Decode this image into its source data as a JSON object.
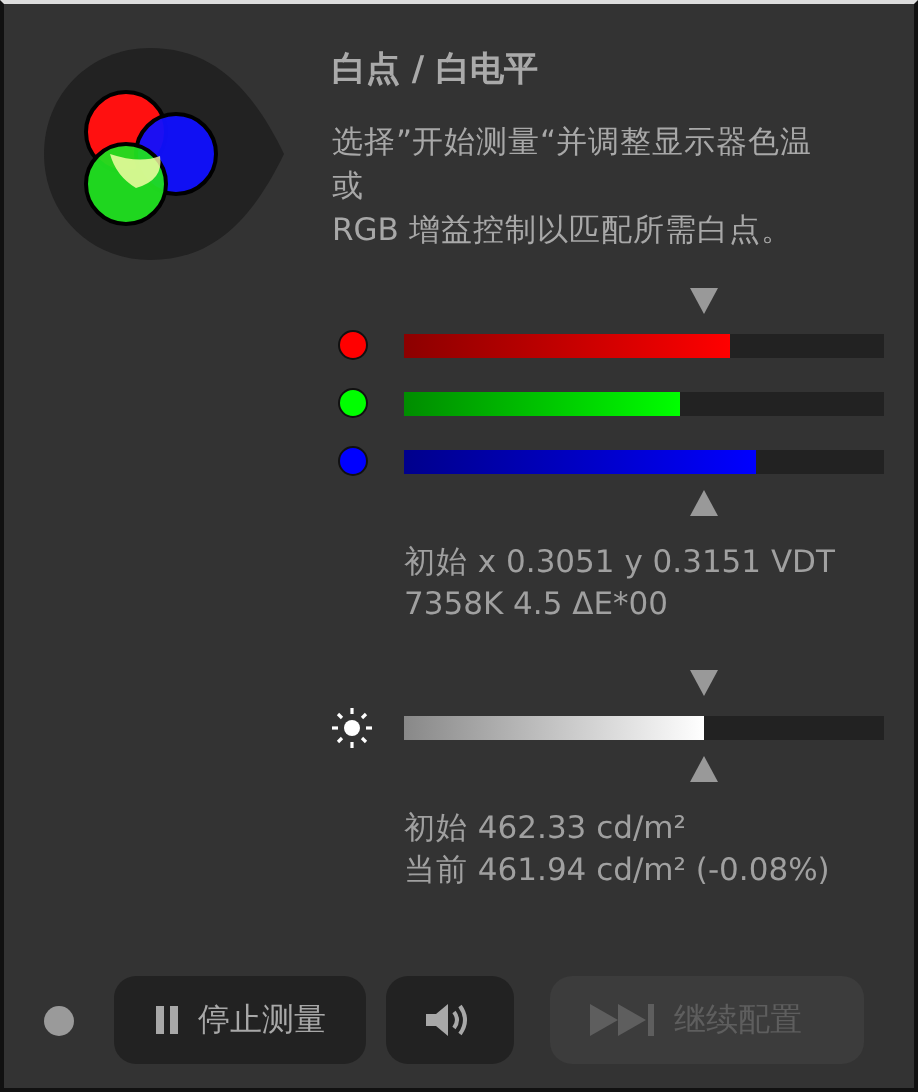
{
  "header": {
    "title": "白点 / 白电平",
    "description_lines": [
      "选择”开始测量“并调整显示器色温",
      "或",
      "RGB 增益控制以匹配所需白点。"
    ]
  },
  "channels": [
    {
      "color": "#ff0000",
      "level": 0.68
    },
    {
      "color": "#00ff00",
      "level": 0.575
    },
    {
      "color": "#0000ff",
      "level": 0.733
    }
  ],
  "chromaticity": [
    "初始 x 0.3051 y 0.3151 VDT",
    "7358K 4.5 ΔE*00"
  ],
  "luminance": {
    "level": 0.625,
    "lines": [
      "初始 462.33 cd/m²",
      "当前 461.94 cd/m² (-0.08%)"
    ]
  },
  "footer": {
    "buttons": [
      {
        "kind": "pause",
        "label": "停止测量",
        "disabled": false
      },
      {
        "kind": "sound",
        "disabled": false
      },
      {
        "kind": "skip",
        "label": "继续配置",
        "disabled": true
      }
    ]
  }
}
